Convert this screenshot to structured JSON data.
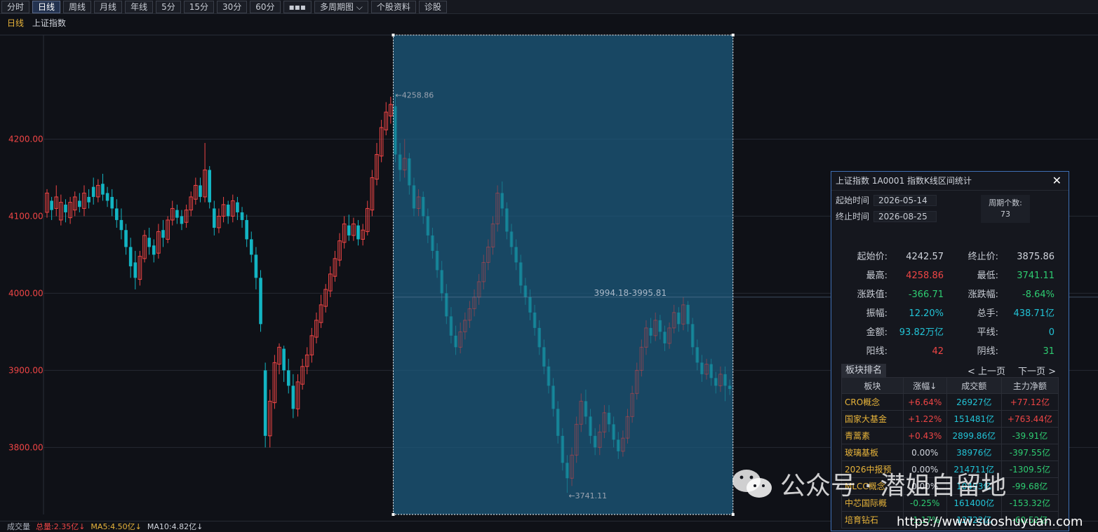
{
  "toolbar": {
    "buttons": [
      "分时",
      "日线",
      "周线",
      "月线",
      "年线",
      "5分",
      "15分",
      "30分",
      "60分",
      "▪▪▪",
      "多周期图 ⌵",
      "个股资料",
      "诊股"
    ],
    "active_index": 1
  },
  "subtitle": {
    "period": "日线",
    "name": "上证指数"
  },
  "chart_data": {
    "type": "candlestick",
    "y_ticks": [
      "4200.00",
      "4100.00",
      "4000.00",
      "3900.00",
      "3800.00"
    ],
    "y_tick_values": [
      4200,
      4100,
      4000,
      3900,
      3800
    ],
    "ylim": [
      3713,
      4335
    ],
    "annotations": {
      "high_label": "←4258.86",
      "low_label": "←3741.11",
      "range_label": "3994.18-3995.81"
    },
    "candles_before": [
      [
        4105,
        4130,
        4098,
        4135
      ],
      [
        4120,
        4108,
        4095,
        4125
      ],
      [
        4110,
        4125,
        4100,
        4140
      ],
      [
        4095,
        4118,
        4088,
        4128
      ],
      [
        4115,
        4105,
        4092,
        4122
      ],
      [
        4098,
        4118,
        4090,
        4125
      ],
      [
        4108,
        4125,
        4100,
        4132
      ],
      [
        4120,
        4112,
        4105,
        4130
      ],
      [
        4110,
        4130,
        4100,
        4140
      ],
      [
        4125,
        4118,
        4110,
        4135
      ],
      [
        4138,
        4125,
        4115,
        4150
      ],
      [
        4125,
        4140,
        4118,
        4148
      ],
      [
        4142,
        4128,
        4120,
        4155
      ],
      [
        4130,
        4120,
        4112,
        4138
      ],
      [
        4125,
        4110,
        4100,
        4135
      ],
      [
        4110,
        4095,
        4085,
        4122
      ],
      [
        4095,
        4082,
        4070,
        4110
      ],
      [
        4082,
        4060,
        4050,
        4090
      ],
      [
        4060,
        4035,
        4020,
        4072
      ],
      [
        4040,
        4020,
        4005,
        4055
      ],
      [
        4018,
        4048,
        4010,
        4055
      ],
      [
        4045,
        4075,
        4040,
        4082
      ],
      [
        4072,
        4060,
        4050,
        4085
      ],
      [
        4062,
        4050,
        4040,
        4070
      ],
      [
        4052,
        4080,
        4045,
        4090
      ],
      [
        4082,
        4072,
        4060,
        4095
      ],
      [
        4070,
        4095,
        4065,
        4100
      ],
      [
        4095,
        4110,
        4088,
        4120
      ],
      [
        4108,
        4098,
        4090,
        4115
      ],
      [
        4100,
        4090,
        4082,
        4108
      ],
      [
        4092,
        4108,
        4085,
        4115
      ],
      [
        4108,
        4125,
        4100,
        4132
      ],
      [
        4122,
        4140,
        4115,
        4150
      ],
      [
        4140,
        4125,
        4118,
        4150
      ],
      [
        4125,
        4160,
        4118,
        4195
      ],
      [
        4160,
        4118,
        4110,
        4165
      ],
      [
        4110,
        4085,
        4075,
        4120
      ],
      [
        4085,
        4100,
        4078,
        4110
      ],
      [
        4100,
        4115,
        4092,
        4125
      ],
      [
        4115,
        4100,
        4090,
        4120
      ],
      [
        4100,
        4120,
        4092,
        4128
      ],
      [
        4118,
        4105,
        4095,
        4125
      ],
      [
        4105,
        4095,
        4085,
        4112
      ],
      [
        4095,
        4070,
        4060,
        4102
      ],
      [
        4070,
        4050,
        4040,
        4080
      ],
      [
        4050,
        4020,
        4005,
        4060
      ],
      [
        4020,
        3960,
        3950,
        4030
      ],
      [
        3900,
        3815,
        3800,
        3910
      ],
      [
        3815,
        3860,
        3800,
        3875
      ],
      [
        3858,
        3910,
        3850,
        3920
      ],
      [
        3908,
        3930,
        3895,
        3935
      ],
      [
        3928,
        3900,
        3885,
        3932
      ],
      [
        3900,
        3880,
        3870,
        3915
      ],
      [
        3880,
        3850,
        3838,
        3895
      ],
      [
        3850,
        3885,
        3840,
        3895
      ],
      [
        3882,
        3905,
        3875,
        3915
      ],
      [
        3905,
        3920,
        3895,
        3930
      ],
      [
        3920,
        3945,
        3910,
        3955
      ],
      [
        3943,
        3965,
        3935,
        3975
      ],
      [
        3962,
        3985,
        3955,
        3998
      ],
      [
        3983,
        4005,
        3975,
        4012
      ],
      [
        4003,
        4025,
        3995,
        4035
      ],
      [
        4022,
        4045,
        4015,
        4055
      ],
      [
        4043,
        4068,
        4035,
        4078
      ],
      [
        4066,
        4090,
        4058,
        4100
      ],
      [
        4088,
        4075,
        4068,
        4102
      ],
      [
        4075,
        4090,
        4068,
        4098
      ],
      [
        4088,
        4070,
        4062,
        4095
      ],
      [
        4070,
        4082,
        4062,
        4090
      ],
      [
        4080,
        4110,
        4075,
        4120
      ],
      [
        4108,
        4150,
        4100,
        4160
      ],
      [
        4148,
        4180,
        4140,
        4195
      ],
      [
        4178,
        4215,
        4170,
        4225
      ],
      [
        4212,
        4235,
        4205,
        4248
      ],
      [
        4230,
        4245,
        4220,
        4255
      ]
    ],
    "candles_selected": [
      [
        4242.57,
        4180,
        4170,
        4258.86
      ],
      [
        4180,
        4160,
        4145,
        4195
      ],
      [
        4160,
        4175,
        4150,
        4200
      ],
      [
        4175,
        4140,
        4128,
        4182
      ],
      [
        4140,
        4110,
        4100,
        4150
      ],
      [
        4110,
        4125,
        4100,
        4135
      ],
      [
        4125,
        4100,
        4090,
        4132
      ],
      [
        4100,
        4075,
        4065,
        4110
      ],
      [
        4075,
        4055,
        4045,
        4085
      ],
      [
        4055,
        4030,
        4020,
        4065
      ],
      [
        4030,
        4000,
        3990,
        4042
      ],
      [
        4000,
        3970,
        3960,
        4012
      ],
      [
        3970,
        3945,
        3935,
        3982
      ],
      [
        3945,
        3930,
        3920,
        3958
      ],
      [
        3930,
        3950,
        3922,
        3962
      ],
      [
        3950,
        3965,
        3940,
        3975
      ],
      [
        3965,
        3980,
        3955,
        3990
      ],
      [
        3980,
        3995,
        3970,
        4005
      ],
      [
        3995,
        4015,
        3985,
        4025
      ],
      [
        4015,
        4040,
        4005,
        4050
      ],
      [
        4040,
        4060,
        4030,
        4070
      ],
      [
        4060,
        4090,
        4050,
        4100
      ],
      [
        4090,
        4130,
        4080,
        4140
      ],
      [
        4130,
        4110,
        4100,
        4145
      ],
      [
        4110,
        4080,
        4070,
        4118
      ],
      [
        4080,
        4060,
        4050,
        4090
      ],
      [
        4060,
        4040,
        4030,
        4070
      ],
      [
        4040,
        4010,
        4000,
        4050
      ],
      [
        4010,
        3995,
        3985,
        4020
      ],
      [
        3995,
        3975,
        3965,
        4005
      ],
      [
        3975,
        3955,
        3945,
        3985
      ],
      [
        3955,
        3930,
        3920,
        3965
      ],
      [
        3930,
        3905,
        3895,
        3940
      ],
      [
        3905,
        3880,
        3870,
        3915
      ],
      [
        3880,
        3850,
        3840,
        3890
      ],
      [
        3850,
        3815,
        3805,
        3860
      ],
      [
        3815,
        3780,
        3770,
        3825
      ],
      [
        3780,
        3760,
        3741.11,
        3790
      ],
      [
        3760,
        3790,
        3750,
        3800
      ],
      [
        3790,
        3830,
        3780,
        3840
      ],
      [
        3830,
        3860,
        3820,
        3870
      ],
      [
        3860,
        3840,
        3830,
        3875
      ],
      [
        3840,
        3815,
        3805,
        3850
      ],
      [
        3815,
        3800,
        3790,
        3825
      ],
      [
        3800,
        3820,
        3790,
        3830
      ],
      [
        3820,
        3845,
        3812,
        3855
      ],
      [
        3845,
        3830,
        3820,
        3855
      ],
      [
        3830,
        3810,
        3800,
        3840
      ],
      [
        3810,
        3795,
        3785,
        3820
      ],
      [
        3795,
        3812,
        3788,
        3822
      ],
      [
        3812,
        3840,
        3805,
        3850
      ],
      [
        3840,
        3870,
        3832,
        3880
      ],
      [
        3870,
        3900,
        3862,
        3910
      ],
      [
        3900,
        3930,
        3892,
        3940
      ],
      [
        3930,
        3955,
        3920,
        3965
      ],
      [
        3955,
        3945,
        3935,
        3968
      ],
      [
        3945,
        3965,
        3938,
        3975
      ],
      [
        3965,
        3950,
        3940,
        3972
      ],
      [
        3950,
        3935,
        3925,
        3958
      ],
      [
        3935,
        3955,
        3928,
        3962
      ],
      [
        3955,
        3975,
        3948,
        3985
      ],
      [
        3975,
        3960,
        3950,
        3982
      ],
      [
        3960,
        3985,
        3952,
        3995
      ],
      [
        3985,
        3960,
        3950,
        3990
      ],
      [
        3960,
        3930,
        3920,
        3968
      ],
      [
        3930,
        3910,
        3900,
        3940
      ],
      [
        3910,
        3895,
        3885,
        3920
      ],
      [
        3895,
        3908,
        3888,
        3915
      ],
      [
        3908,
        3890,
        3880,
        3915
      ],
      [
        3890,
        3880,
        3870,
        3898
      ],
      [
        3880,
        3895,
        3872,
        3905
      ],
      [
        3895,
        3880,
        3860,
        3905
      ],
      [
        3880,
        3875.86,
        3868,
        3888
      ]
    ]
  },
  "volume_bar": {
    "label": "成交量",
    "total": "总量:2.35亿↓",
    "ma5": "MA5:4.50亿↓",
    "ma10": "MA10:4.82亿↓"
  },
  "panel": {
    "title": "上证指数  1A0001  指数K线区间统计",
    "close": "✕",
    "start_label": "起始时间",
    "start_value": "2026-05-14",
    "end_label": "终止时间",
    "end_value": "2026-08-25",
    "cycle_label": "周期个数:",
    "cycle_value": "73",
    "stats": {
      "start_price_k": "起始价:",
      "start_price_v": "4242.57",
      "end_price_k": "终止价:",
      "end_price_v": "3875.86",
      "high_k": "最高:",
      "high_v": "4258.86",
      "low_k": "最低:",
      "low_v": "3741.11",
      "chg_k": "涨跌值:",
      "chg_v": "-366.71",
      "chgp_k": "涨跌幅:",
      "chgp_v": "-8.64%",
      "amp_k": "振幅:",
      "amp_v": "12.20%",
      "hand_k": "总手:",
      "hand_v": "438.71亿",
      "amt_k": "金额:",
      "amt_v": "93.82万亿",
      "flat_k": "平线:",
      "flat_v": "0",
      "up_k": "阳线:",
      "up_v": "42",
      "down_k": "阴线:",
      "down_v": "31"
    },
    "rank_title": "板块排名",
    "prev": "< 上一页",
    "next": "下一页 >",
    "headers": [
      "板块",
      "涨幅↓",
      "成交额",
      "主力净额"
    ],
    "rows": [
      [
        "CRO概念",
        "+6.64%",
        "26927亿",
        "+77.12亿"
      ],
      [
        "国家大基金",
        "+1.22%",
        "151481亿",
        "+763.44亿"
      ],
      [
        "青蒿素",
        "+0.43%",
        "2899.86亿",
        "-39.91亿"
      ],
      [
        "玻璃基板",
        "0.00%",
        "38976亿",
        "-397.55亿"
      ],
      [
        "2026中报预",
        "0.00%",
        "214711亿",
        "-1309.5亿"
      ],
      [
        "MLCC概念",
        "0.00%",
        "10493亿",
        "-99.68亿"
      ],
      [
        "中芯国际概",
        "-0.25%",
        "161400亿",
        "-153.32亿"
      ],
      [
        "培育钻石",
        "-1.17%",
        "12722亿",
        "-60.52亿"
      ]
    ]
  },
  "watermark": {
    "text": "公众号 · 潜姐自留地",
    "url": "https://www.suoshuyuan.com"
  },
  "colors": {
    "up": "#ef4545",
    "down": "#13b5c3",
    "selection": "#1c5a7e"
  }
}
